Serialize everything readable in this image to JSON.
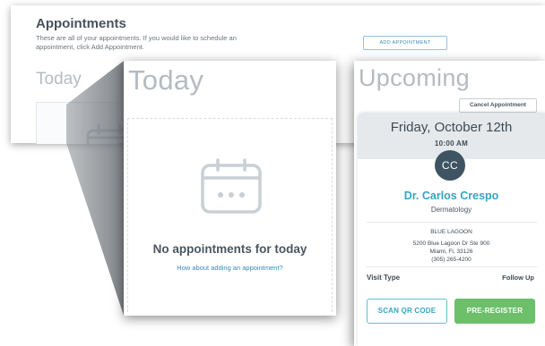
{
  "background_page": {
    "title": "Appointments",
    "subtitle": "These are all of your appointments. If you would like to schedule an appointment, click Add Appointment.",
    "add_button": "ADD APPOINTMENT",
    "today_heading": "Today"
  },
  "today_panel": {
    "heading": "Today",
    "empty_message": "No appointments for today",
    "add_link": "How about adding an appointment?",
    "icon": "calendar-icon"
  },
  "upcoming_panel": {
    "heading": "Upcoming",
    "cancel_button": "Cancel Appointment",
    "appointment": {
      "date": "Friday, October 12th",
      "time": "10:00 AM",
      "avatar_initials": "CC",
      "doctor": "Dr. Carlos Crespo",
      "specialty": "Dermatology",
      "clinic": "BLUE LAGOON",
      "address_line1": "5200 Blue Lagoon Dr Ste 900",
      "address_line2": "Miami, Fl, 33126",
      "phone": "(305) 265-4200",
      "visit_type_label": "Visit Type",
      "visit_type_value": "Follow Up",
      "scan_button": "SCAN QR CODE",
      "preregister_button": "PRE-REGISTER"
    }
  },
  "colors": {
    "accent_teal": "#35a5bf",
    "button_green": "#6cc06a",
    "avatar_bg": "#3e5462",
    "link_blue": "#3d87b8",
    "muted_heading": "#b4bbc1"
  }
}
